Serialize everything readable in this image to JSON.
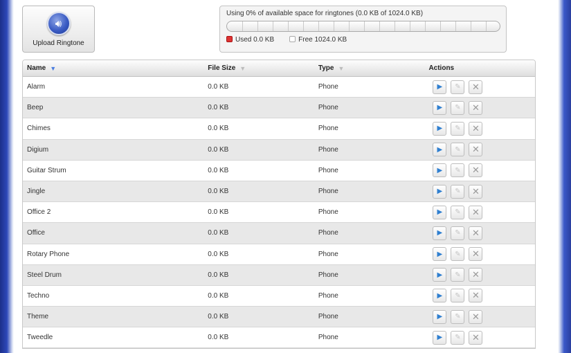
{
  "upload": {
    "label": "Upload Ringtone",
    "icon": "speaker-icon"
  },
  "usage": {
    "text": "Using 0% of available space for ringtones (0.0 KB of 1024.0 KB)",
    "used_fraction": 0,
    "used_label": "Used 0.0 KB",
    "free_label": "Free 1024.0 KB",
    "used_color": "#dd3333"
  },
  "table": {
    "columns": [
      {
        "label": "Name",
        "sort_icon": "double-chevron-down-icon",
        "active": true
      },
      {
        "label": "File Size",
        "sort_icon": "double-chevron-down-icon",
        "active": false
      },
      {
        "label": "Type",
        "sort_icon": "double-chevron-down-icon",
        "active": false
      },
      {
        "label": "Actions"
      }
    ],
    "rows": [
      {
        "name": "Alarm",
        "size": "0.0 KB",
        "type": "Phone"
      },
      {
        "name": "Beep",
        "size": "0.0 KB",
        "type": "Phone"
      },
      {
        "name": "Chimes",
        "size": "0.0 KB",
        "type": "Phone"
      },
      {
        "name": "Digium",
        "size": "0.0 KB",
        "type": "Phone"
      },
      {
        "name": "Guitar Strum",
        "size": "0.0 KB",
        "type": "Phone"
      },
      {
        "name": "Jingle",
        "size": "0.0 KB",
        "type": "Phone"
      },
      {
        "name": "Office 2",
        "size": "0.0 KB",
        "type": "Phone"
      },
      {
        "name": "Office",
        "size": "0.0 KB",
        "type": "Phone"
      },
      {
        "name": "Rotary Phone",
        "size": "0.0 KB",
        "type": "Phone"
      },
      {
        "name": "Steel Drum",
        "size": "0.0 KB",
        "type": "Phone"
      },
      {
        "name": "Techno",
        "size": "0.0 KB",
        "type": "Phone"
      },
      {
        "name": "Theme",
        "size": "0.0 KB",
        "type": "Phone"
      },
      {
        "name": "Tweedle",
        "size": "0.0 KB",
        "type": "Phone"
      }
    ],
    "actions": [
      "play-icon",
      "pencil-icon",
      "delete-x-icon"
    ]
  }
}
